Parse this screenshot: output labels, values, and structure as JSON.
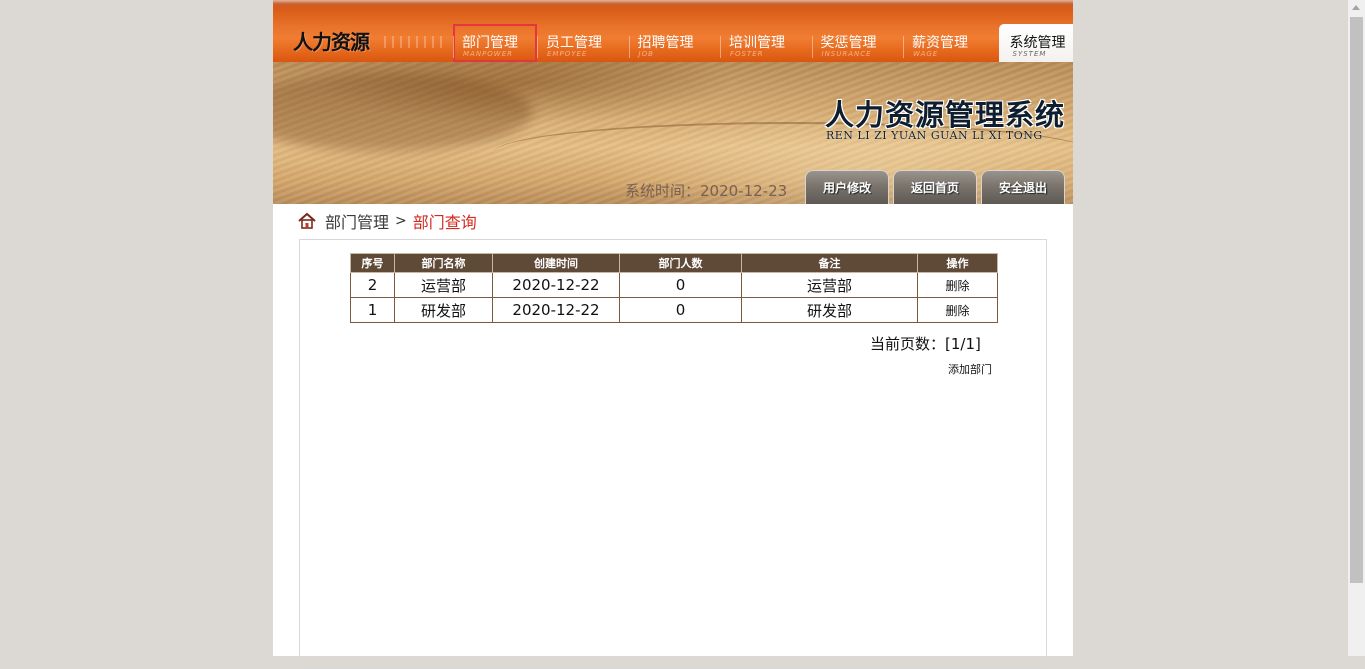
{
  "app": {
    "logo": "人力资源",
    "title": "人力资源管理系统",
    "subtitle": "REN LI ZI YUAN GUAN LI XI TONG"
  },
  "nav": {
    "items": [
      {
        "label": "部门管理",
        "en": "MANPOWER"
      },
      {
        "label": "员工管理",
        "en": "EMPOYEE"
      },
      {
        "label": "招聘管理",
        "en": "JOB"
      },
      {
        "label": "培训管理",
        "en": "FOSTER"
      },
      {
        "label": "奖惩管理",
        "en": "INSURANCE"
      },
      {
        "label": "薪资管理",
        "en": "WAGE"
      },
      {
        "label": "系统管理",
        "en": "SYSTEM"
      }
    ]
  },
  "header": {
    "systime_label": "系统时间：2020-12-23",
    "buttons": {
      "user_edit": "用户修改",
      "home": "返回首页",
      "logout": "安全退出"
    }
  },
  "breadcrumb": {
    "parent": "部门管理",
    "separator": ">",
    "current": "部门查询"
  },
  "table": {
    "headers": [
      "序号",
      "部门名称",
      "创建时间",
      "部门人数",
      "备注",
      "操作"
    ],
    "rows": [
      {
        "id": "2",
        "name": "运营部",
        "created": "2020-12-22",
        "count": "0",
        "note": "运营部",
        "op": "删除"
      },
      {
        "id": "1",
        "name": "研发部",
        "created": "2020-12-22",
        "count": "0",
        "note": "研发部",
        "op": "删除"
      }
    ]
  },
  "pager": {
    "text": "当前页数：[1/1]"
  },
  "actions": {
    "add": "添加部门"
  },
  "colors": {
    "nav_orange": "#e8722a",
    "table_header": "#5f4a38",
    "breadcrumb_current": "#d22a1f",
    "highlight_box": "#e5353d"
  }
}
